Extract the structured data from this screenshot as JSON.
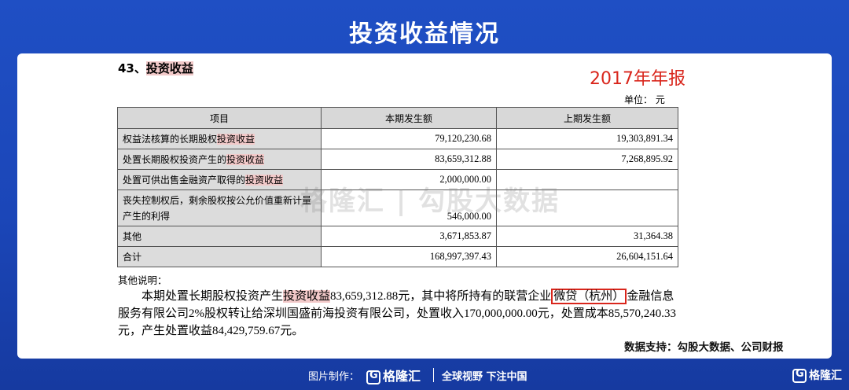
{
  "page_title": "投资收益情况",
  "section": {
    "number": "43、",
    "title": "投资收益"
  },
  "year_label": "2017年年报",
  "unit": "单位：  元",
  "table": {
    "headers": [
      "项目",
      "本期发生额",
      "上期发生额"
    ],
    "rows": [
      {
        "prefix": "权益法核算的长期股权",
        "hl": "投资收益",
        "current": "79,120,230.68",
        "previous": "19,303,891.34"
      },
      {
        "prefix": "处置长期股权投资产生的",
        "hl": "投资收益",
        "current": "83,659,312.88",
        "previous": "7,268,895.92"
      },
      {
        "prefix": "处置可供出售金融资产取得的",
        "hl": "投资收益",
        "current": "2,000,000.00",
        "previous": ""
      },
      {
        "prefix": "丧失控制权后，剩余股权按公允价值重新计量产生的利得",
        "hl": "",
        "current": "546,000.00",
        "previous": ""
      },
      {
        "prefix": "其他",
        "hl": "",
        "current": "3,671,853.87",
        "previous": "31,364.38"
      },
      {
        "prefix": "合计",
        "hl": "",
        "current": "168,997,397.43",
        "previous": "26,604,151.64"
      }
    ]
  },
  "notes_title": "其他说明：",
  "paragraph": {
    "p1": "本期处置长期股权投资产生",
    "hl": "投资收益",
    "p2": "83,659,312.88元，其中将所持有的联营企业",
    "boxed": "微贷（杭州）",
    "p3": "金融信息服务有限公司2%股权转让给深圳国盛前海投资有限公司，处置收入170,000,000.00元，处置成本85,570,240.33元，产生处置收益84,429,759.67元。"
  },
  "source": "数据支持：勾股大数据、公司财报",
  "watermark": "格隆汇 | 勾股大数据",
  "footer": {
    "made_by": "图片制作：",
    "logo": "格隆汇",
    "slogan": "全球视野 下注中国",
    "corner": "格隆汇"
  }
}
